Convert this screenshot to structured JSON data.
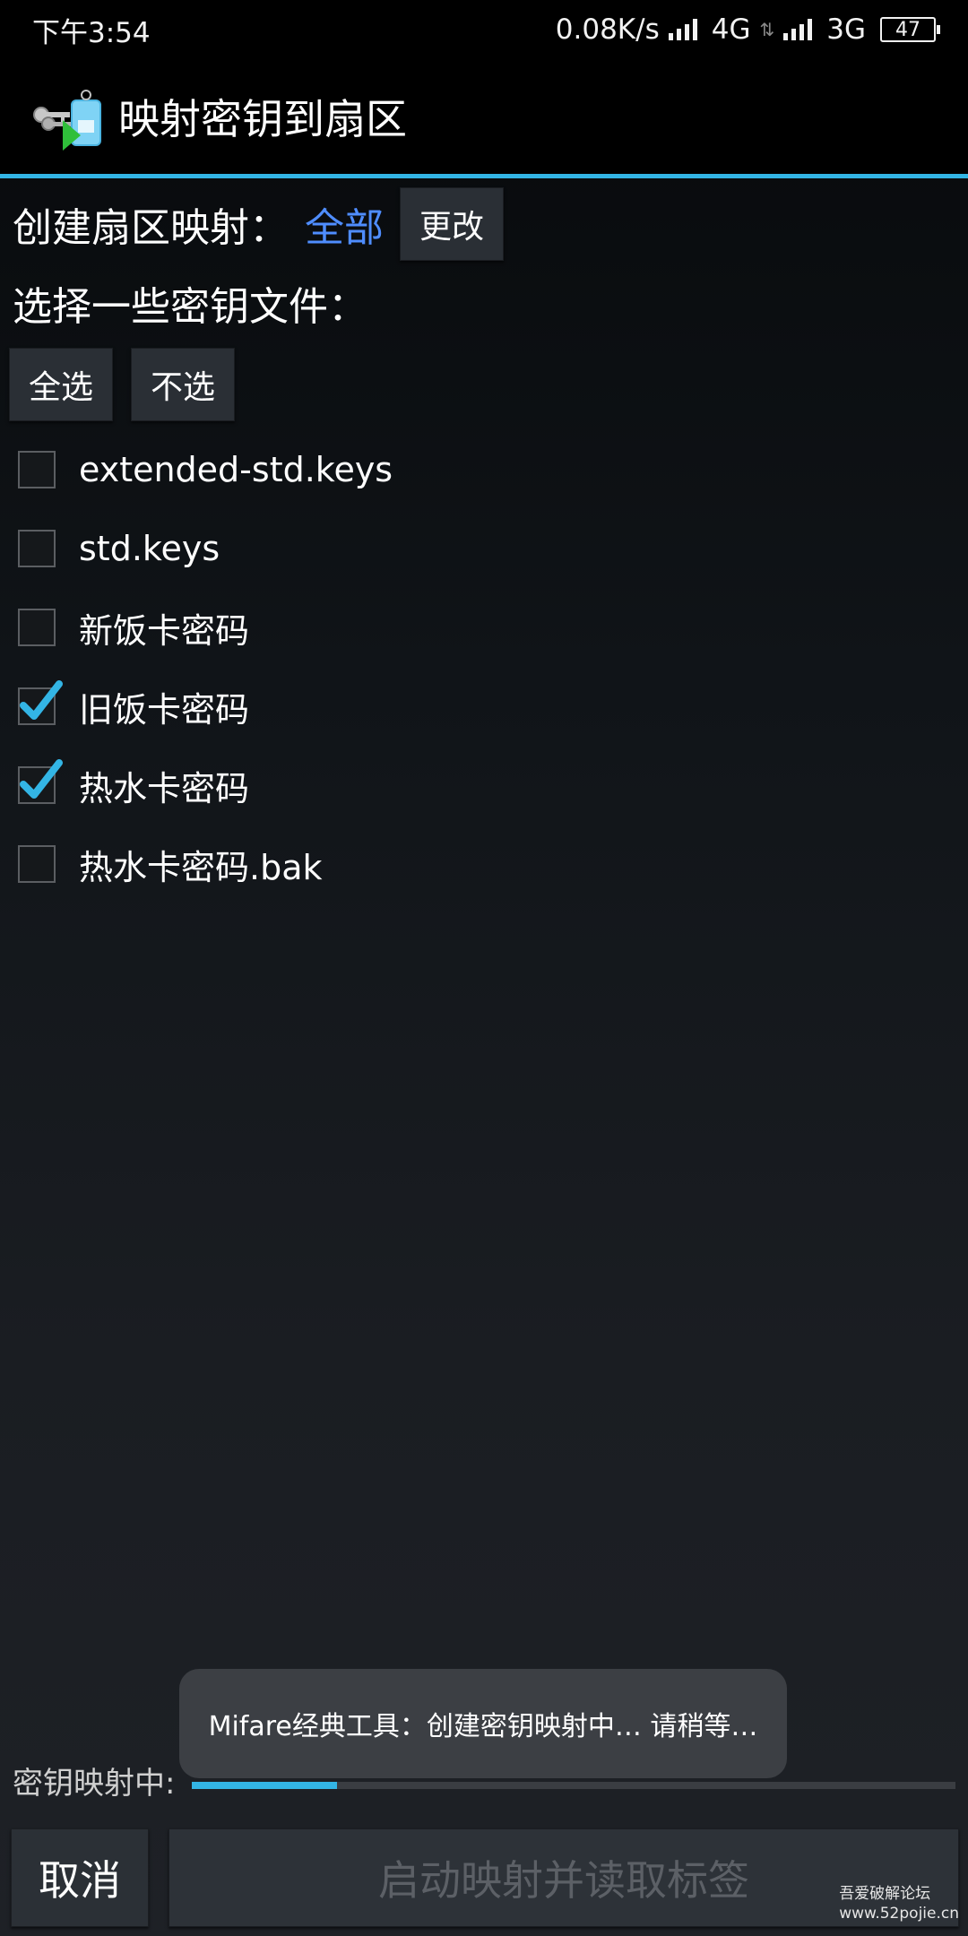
{
  "status_bar": {
    "time": "下午3:54",
    "net_speed": "0.08K/s",
    "net1": "4G",
    "net2": "3G",
    "battery": "47"
  },
  "app": {
    "title": "映射密钥到扇区",
    "icon": "key-tag-icon"
  },
  "sector_map": {
    "label": "创建扇区映射：",
    "value": "全部",
    "change_label": "更改"
  },
  "key_select": {
    "label": "选择一些密钥文件：",
    "select_all_label": "全选",
    "select_none_label": "不选"
  },
  "key_files": [
    {
      "name": "extended-std.keys",
      "checked": false
    },
    {
      "name": "std.keys",
      "checked": false
    },
    {
      "name": "新饭卡密码",
      "checked": false
    },
    {
      "name": "旧饭卡密码",
      "checked": true
    },
    {
      "name": "热水卡密码",
      "checked": true
    },
    {
      "name": "热水卡密码.bak",
      "checked": false
    }
  ],
  "toast": {
    "text": "Mifare经典工具：创建密钥映射中… 请稍等…"
  },
  "progress": {
    "label": "密钥映射中:",
    "fraction": 0.19
  },
  "buttons": {
    "cancel_label": "取消",
    "start_label": "启动映射并读取标签"
  },
  "watermark": {
    "line1": "吾爱破解论坛",
    "line2": "www.52pojie.cn"
  },
  "colors": {
    "accent": "#33b5e5",
    "link": "#4f8dff"
  }
}
